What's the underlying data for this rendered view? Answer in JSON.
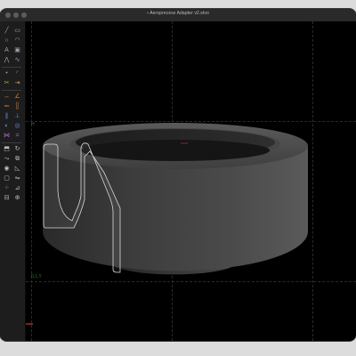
{
  "window": {
    "title": "Aeroprecess Adapter v2.stvo",
    "title_icon": "document-icon"
  },
  "canvas": {
    "corner_label_top": "H",
    "corner_label_bottom": "0,1,Y"
  },
  "toolbar": {
    "groups": [
      [
        {
          "icon": "line-icon",
          "color": "#9aa2ad"
        },
        {
          "icon": "rectangle-icon",
          "color": "#9aa2ad"
        }
      ],
      [
        {
          "icon": "circle-icon",
          "color": "#9aa2ad"
        },
        {
          "icon": "arc-icon",
          "color": "#9aa2ad"
        }
      ],
      [
        {
          "icon": "text-icon",
          "color": "#9aa2ad"
        },
        {
          "icon": "image-icon",
          "color": "#9aa2ad"
        }
      ],
      [
        {
          "icon": "polyline-icon",
          "color": "#9aa2ad"
        },
        {
          "icon": "spline-icon",
          "color": "#9aa2ad"
        }
      ],
      [
        {
          "icon": "point-icon",
          "color": "#6cb86a"
        },
        {
          "icon": "fillet-icon",
          "color": "#6cb86a"
        }
      ],
      [
        {
          "icon": "trim-icon",
          "color": "#b9a14a"
        },
        {
          "icon": "extend-icon",
          "color": "#b9a14a"
        }
      ],
      [
        {
          "icon": "dimension-icon",
          "color": "#d97b2e"
        },
        {
          "icon": "angle-dimension-icon",
          "color": "#d97b2e"
        }
      ],
      [
        {
          "icon": "horizontal-constraint-icon",
          "color": "#d97b2e"
        },
        {
          "icon": "vertical-constraint-icon",
          "color": "#d97b2e"
        }
      ],
      [
        {
          "icon": "parallel-constraint-icon",
          "color": "#5d8fd6"
        },
        {
          "icon": "perpendicular-constraint-icon",
          "color": "#5d8fd6"
        }
      ],
      [
        {
          "icon": "tangent-constraint-icon",
          "color": "#5d8fd6"
        },
        {
          "icon": "coincident-constraint-icon",
          "color": "#5d8fd6"
        }
      ],
      [
        {
          "icon": "symmetric-constraint-icon",
          "color": "#a56bd1"
        },
        {
          "icon": "equal-constraint-icon",
          "color": "#a56bd1"
        }
      ],
      [
        {
          "icon": "extrude-icon",
          "color": "#bcbcbc"
        },
        {
          "icon": "revolve-icon",
          "color": "#bcbcbc"
        }
      ],
      [
        {
          "icon": "sweep-icon",
          "color": "#bcbcbc"
        },
        {
          "icon": "loft-icon",
          "color": "#bcbcbc"
        }
      ],
      [
        {
          "icon": "hole-icon",
          "color": "#bcbcbc"
        },
        {
          "icon": "chamfer-icon",
          "color": "#bcbcbc"
        }
      ],
      [
        {
          "icon": "shell-icon",
          "color": "#bcbcbc"
        },
        {
          "icon": "mirror-icon",
          "color": "#bcbcbc"
        }
      ],
      [
        {
          "icon": "pattern-icon",
          "color": "#bcbcbc"
        },
        {
          "icon": "measure-icon",
          "color": "#bcbcbc"
        }
      ],
      [
        {
          "icon": "section-icon",
          "color": "#bcbcbc"
        },
        {
          "icon": "boolean-icon",
          "color": "#bcbcbc"
        }
      ]
    ]
  },
  "colors": {
    "axis_x": "#d32f2f",
    "axis_y": "#2f6ad3",
    "guide": "#2b2b2b",
    "sketch": "#d7d7d7"
  }
}
